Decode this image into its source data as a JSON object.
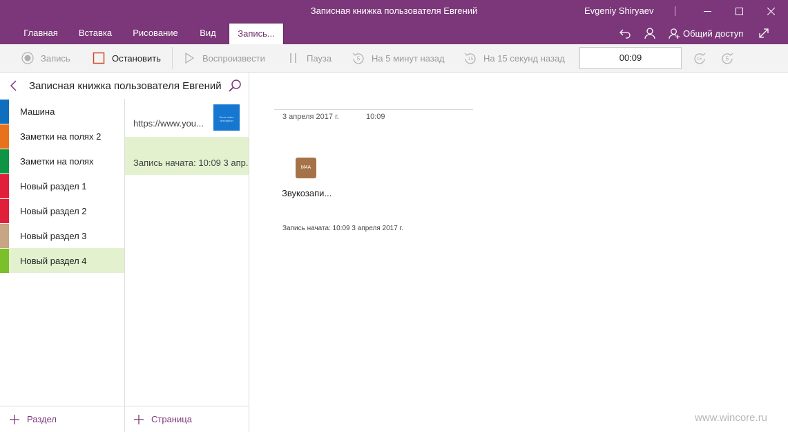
{
  "window": {
    "title": "Записная книжка пользователя Евгений",
    "user": "Evgeniy Shiryaev"
  },
  "tabs": [
    {
      "label": "Главная"
    },
    {
      "label": "Вставка"
    },
    {
      "label": "Рисование"
    },
    {
      "label": "Вид"
    },
    {
      "label": "Запись..."
    }
  ],
  "header_actions": {
    "share_label": "Общий доступ"
  },
  "toolbar": {
    "record": "Запись",
    "stop": "Остановить",
    "play": "Воспроизвести",
    "pause": "Пауза",
    "back5": "На 5 минут назад",
    "back15": "На 15 секунд назад",
    "timer": "00:09",
    "back5_num": "5",
    "back15_num": "15"
  },
  "notebook": {
    "name": "Записная книжка пользователя Евгений"
  },
  "sections": [
    {
      "label": "Машина",
      "color": "#0f6fbf"
    },
    {
      "label": "Заметки на полях 2",
      "color": "#e8711b"
    },
    {
      "label": "Заметки на полях",
      "color": "#0e9445"
    },
    {
      "label": "Новый раздел 1",
      "color": "#e0203b"
    },
    {
      "label": "Новый раздел  2",
      "color": "#e0203b"
    },
    {
      "label": "Новый раздел  3",
      "color": "#c6a683"
    },
    {
      "label": "Новый раздел  4",
      "color": "#7bbf2a"
    }
  ],
  "pages": [
    {
      "label": "https://www.you...",
      "thumb_text": "Some video description"
    },
    {
      "label": "Запись начата: 10:09 3 апр..."
    }
  ],
  "footer": {
    "add_section": "Раздел",
    "add_page": "Страница"
  },
  "content": {
    "date": "3 апреля 2017 г.",
    "time": "10:09",
    "attachment_icon": "M4A",
    "attachment_name": "Звукозапи...",
    "recording_started": "Запись начата: 10:09 3 апреля 2017 г."
  },
  "watermark": "www.wincore.ru",
  "colors": {
    "accent": "#7b3779",
    "selected_bg": "#e3f1cf"
  }
}
